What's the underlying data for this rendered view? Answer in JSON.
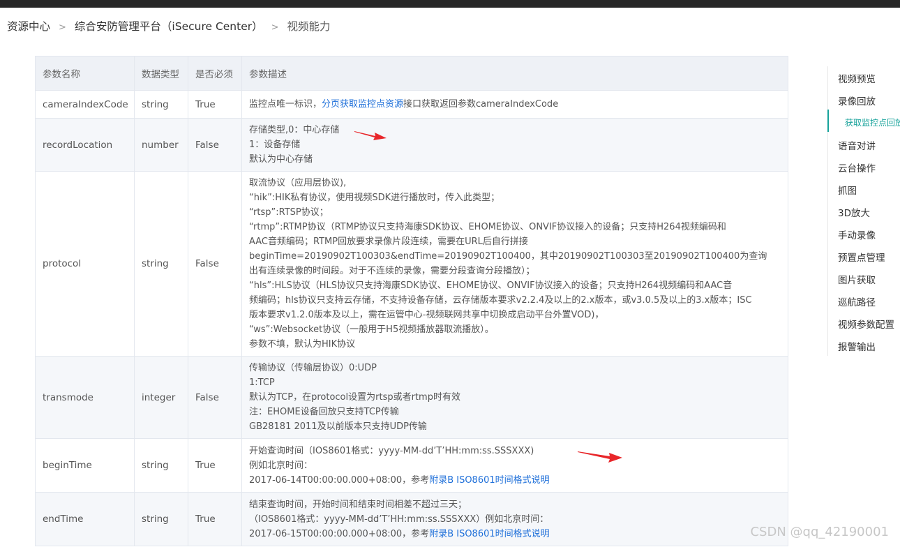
{
  "breadcrumb": {
    "items": [
      "资源中心",
      "综合安防管理平台（iSecure Center）",
      "视频能力"
    ],
    "separator": ">"
  },
  "table": {
    "headers": [
      "参数名称",
      "数据类型",
      "是否必须",
      "参数描述"
    ],
    "rows": [
      {
        "name": "cameraIndexCode",
        "type": "string",
        "required": "True",
        "desc": {
          "pre": "监控点唯一标识，",
          "link": "分页获取监控点资源",
          "post": "接口获取返回参数cameraIndexCode"
        }
      },
      {
        "name": "recordLocation",
        "type": "number",
        "required": "False",
        "desc": [
          "存储类型,0：中心存储",
          "1：设备存储",
          "默认为中心存储"
        ]
      },
      {
        "name": "protocol",
        "type": "string",
        "required": "False",
        "desc": [
          "取流协议（应用层协议),",
          "“hik”:HIK私有协议，使用视频SDK进行播放时，传入此类型；",
          "“rtsp”:RTSP协议；",
          "“rtmp”:RTMP协议（RTMP协议只支持海康SDK协议、EHOME协议、ONVIF协议接入的设备；只支持H264视频编码和",
          "AAC音频编码；RTMP回放要求录像片段连续，需要在URL后自行拼接",
          "beginTime=20190902T100303&endTime=20190902T100400，其中20190902T100303至20190902T100400为查询",
          "出有连续录像的时间段。对于不连续的录像，需要分段查询分段播放）；",
          "“hls”:HLS协议（HLS协议只支持海康SDK协议、EHOME协议、ONVIF协议接入的设备；只支持H264视频编码和AAC音",
          "频编码；hls协议只支持云存储，不支持设备存储，云存储版本要求v2.2.4及以上的2.x版本，或v3.0.5及以上的3.x版本；ISC",
          "版本要求v1.2.0版本及以上，需在运管中心-视频联网共享中切换成启动平台外置VOD)，",
          "“ws”:Websocket协议（一般用于H5视频播放器取流播放）。",
          "参数不填，默认为HIK协议"
        ]
      },
      {
        "name": "transmode",
        "type": "integer",
        "required": "False",
        "desc": [
          "传输协议（传输层协议）0:UDP",
          "1:TCP",
          "默认为TCP，在protocol设置为rtsp或者rtmp时有效",
          "注：EHOME设备回放只支持TCP传输",
          "GB28181 2011及以前版本只支持UDP传输"
        ]
      },
      {
        "name": "beginTime",
        "type": "string",
        "required": "True",
        "desc": {
          "lines": [
            "开始查询时间（IOS8601格式：yyyy-MM-dd’T’HH:mm:ss.SSSXXX)",
            "例如北京时间："
          ],
          "last_pre": "2017-06-14T00:00:00.000+08:00，参考",
          "link": "附录B ISO8601时间格式说明"
        }
      },
      {
        "name": "endTime",
        "type": "string",
        "required": "True",
        "desc": {
          "lines": [
            "结束查询时间，开始时间和结束时间相差不超过三天；",
            "（IOS8601格式：yyyy-MM-dd’T’HH:mm:ss.SSSXXX）例如北京时间："
          ],
          "last_pre": "2017-06-15T00:00:00.000+08:00，参考",
          "link": "附录B ISO8601时间格式说明"
        }
      }
    ]
  },
  "sidebar": {
    "items": [
      "视频预览",
      "录像回放",
      "获取监控点回放",
      "语音对讲",
      "云台操作",
      "抓图",
      "3D放大",
      "手动录像",
      "预置点管理",
      "图片获取",
      "巡航路径",
      "视频参数配置",
      "报警输出"
    ],
    "active_index": 2,
    "accent": "#16a29a"
  },
  "watermark": "CSDN @qq_42190001",
  "colors": {
    "link": "#1e6fd9",
    "header_bg": "#eef1f6",
    "arrow": "#e8262a"
  }
}
